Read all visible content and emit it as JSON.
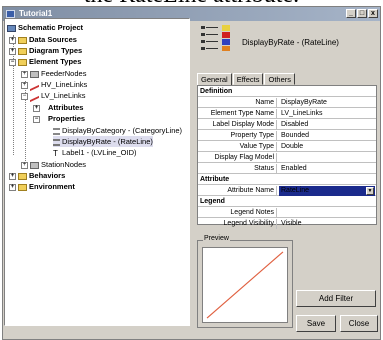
{
  "cropped_caption": "the RateLine attribute.",
  "window": {
    "title": "Tutorial1",
    "minimize": "_",
    "maximize": "□",
    "close": "x"
  },
  "tree": {
    "root": "Schematic Project",
    "data_sources": "Data Sources",
    "diagram_types": "Diagram Types",
    "element_types": "Element Types",
    "feeder_nodes": "FeederNodes",
    "hv_linelinks": "HV_LineLinks",
    "lv_linelinks": "LV_LineLinks",
    "attributes": "Attributes",
    "properties": "Properties",
    "display_by_category": "DisplayByCategory - (CategoryLine)",
    "display_by_rate": "DisplayByRate - (RateLine)",
    "label1": "Label1 - (LVLine_OID)",
    "station_nodes": "StationNodes",
    "behaviors": "Behaviors",
    "environment": "Environment"
  },
  "header": {
    "title": "DisplayByRate - (RateLine)"
  },
  "tabs": [
    "General",
    "Effects",
    "Others"
  ],
  "grid": {
    "definition": "Definition",
    "rows_def": [
      {
        "k": "Name",
        "v": "DisplayByRate"
      },
      {
        "k": "Element Type Name",
        "v": "LV_LineLinks"
      },
      {
        "k": "Label Display Mode",
        "v": "Disabled"
      },
      {
        "k": "Property Type",
        "v": "Bounded"
      },
      {
        "k": "Value Type",
        "v": "Double"
      },
      {
        "k": "Display Flag Model",
        "v": ""
      },
      {
        "k": "Status",
        "v": "Enabled"
      }
    ],
    "attribute": "Attribute",
    "attribute_name_label": "Attribute Name",
    "attribute_name_value": "RateLine",
    "legend": "Legend",
    "legend_notes_label": "Legend Notes",
    "legend_notes_value": "",
    "legend_visibility_label": "Legend Visibility",
    "legend_visibility_value": "Visible"
  },
  "preview": {
    "label": "Preview",
    "line_color": "#e06040"
  },
  "buttons": {
    "add_filter": "Add Filter",
    "save": "Save",
    "close": "Close"
  }
}
